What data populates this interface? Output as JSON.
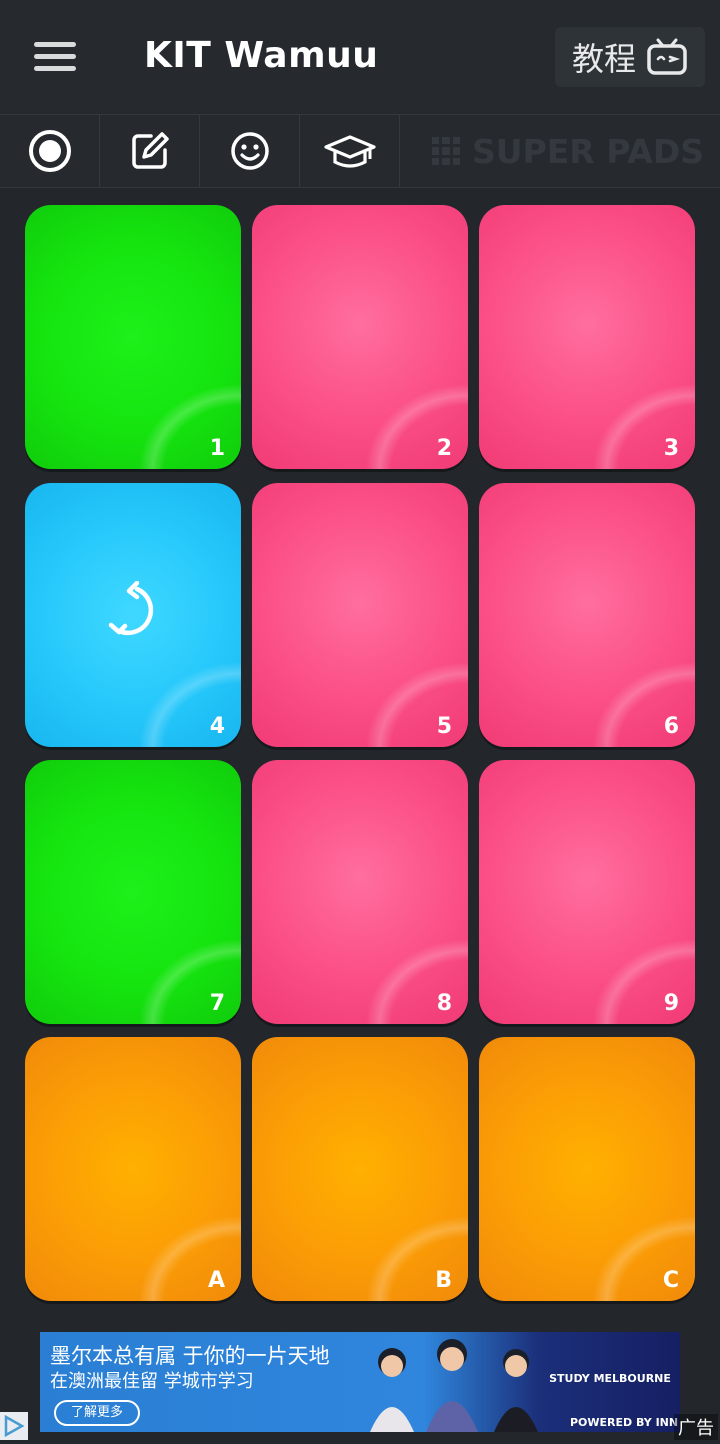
{
  "app": {
    "title": "KIT Wamuu",
    "tutorial_label": "教程",
    "brand": "SUPER PADS"
  },
  "toolbar": {
    "items": [
      {
        "icon": "record-icon"
      },
      {
        "icon": "edit-icon"
      },
      {
        "icon": "smiley-icon"
      },
      {
        "icon": "graduation-cap-icon"
      }
    ]
  },
  "pads": [
    {
      "label": "1",
      "color": "green"
    },
    {
      "label": "2",
      "color": "pink"
    },
    {
      "label": "3",
      "color": "pink"
    },
    {
      "label": "4",
      "color": "blue",
      "icon": "loop-icon"
    },
    {
      "label": "5",
      "color": "pink"
    },
    {
      "label": "6",
      "color": "pink"
    },
    {
      "label": "7",
      "color": "green"
    },
    {
      "label": "8",
      "color": "pink"
    },
    {
      "label": "9",
      "color": "pink"
    },
    {
      "label": "A",
      "color": "orange"
    },
    {
      "label": "B",
      "color": "orange"
    },
    {
      "label": "C",
      "color": "orange"
    }
  ],
  "colors": {
    "green": "#15e40f",
    "pink": "#fb4f86",
    "blue": "#26c8fb",
    "orange": "#fb9c06",
    "background": "#23272c"
  },
  "ad": {
    "line1": "墨尔本总有属 于你的一片天地",
    "line2": "在澳洲最佳留 学城市学习",
    "cta": "了解更多",
    "brand": "STUDY MELBOURNE",
    "powered": "POWERED BY INN",
    "ad_label": "广告"
  }
}
